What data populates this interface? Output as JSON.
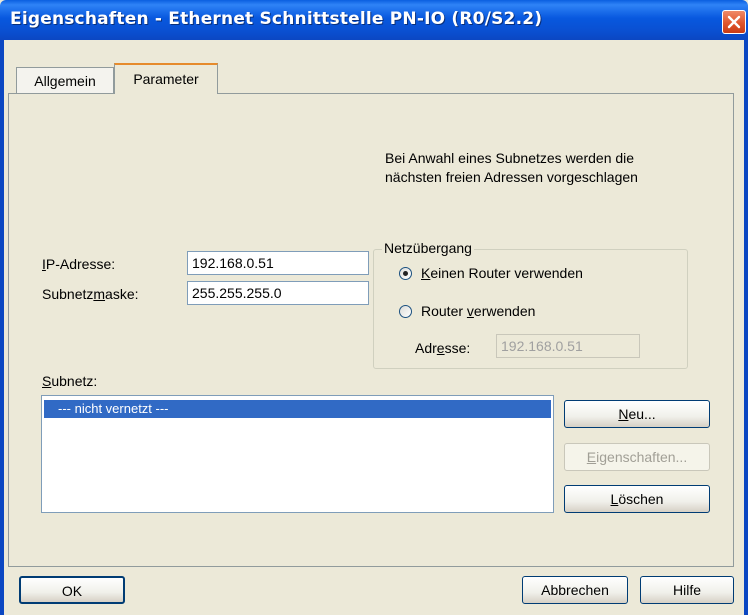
{
  "window": {
    "title": "Eigenschaften - Ethernet Schnittstelle  PN-IO (R0/S2.2)"
  },
  "tabs": [
    {
      "label": "Allgemein"
    },
    {
      "label": "Parameter",
      "active": true
    }
  ],
  "hint": {
    "line1": "Bei Anwahl eines Subnetzes werden die",
    "line2": "nächsten freien Adressen vorgeschlagen"
  },
  "ip": {
    "label_u": "I",
    "label_rest": "P-Adresse:",
    "value": "192.168.0.51"
  },
  "mask": {
    "label_pre": "Subnetz",
    "label_u": "m",
    "label_rest": "aske:",
    "value": "255.255.255.0"
  },
  "gateway": {
    "group_label": "Netzübergang",
    "no_router": {
      "label_u": "K",
      "label_rest": "einen Router verwenden",
      "selected": true
    },
    "use_router": {
      "label_pre": "Router ",
      "label_u": "v",
      "label_rest": "erwenden",
      "selected": false
    },
    "address": {
      "label_pre": "Adr",
      "label_u": "e",
      "label_rest": "sse:",
      "value": "192.168.0.51"
    }
  },
  "subnet": {
    "label_u": "S",
    "label_rest": "ubnetz:",
    "items": [
      "--- nicht vernetzt ---"
    ],
    "buttons": {
      "new": {
        "label_u": "N",
        "label_rest": "eu..."
      },
      "properties": {
        "label_u": "E",
        "label_rest": "igenschaften..."
      },
      "delete": {
        "label_u": "L",
        "label_rest": "öschen"
      }
    }
  },
  "footer": {
    "ok": "OK",
    "cancel": "Abbrechen",
    "help": "Hilfe"
  },
  "colors": {
    "titlebar": "#0a5fe0",
    "selection": "#316ac5",
    "tab_highlight": "#e68b2c",
    "radio_dot": "#21a121"
  }
}
